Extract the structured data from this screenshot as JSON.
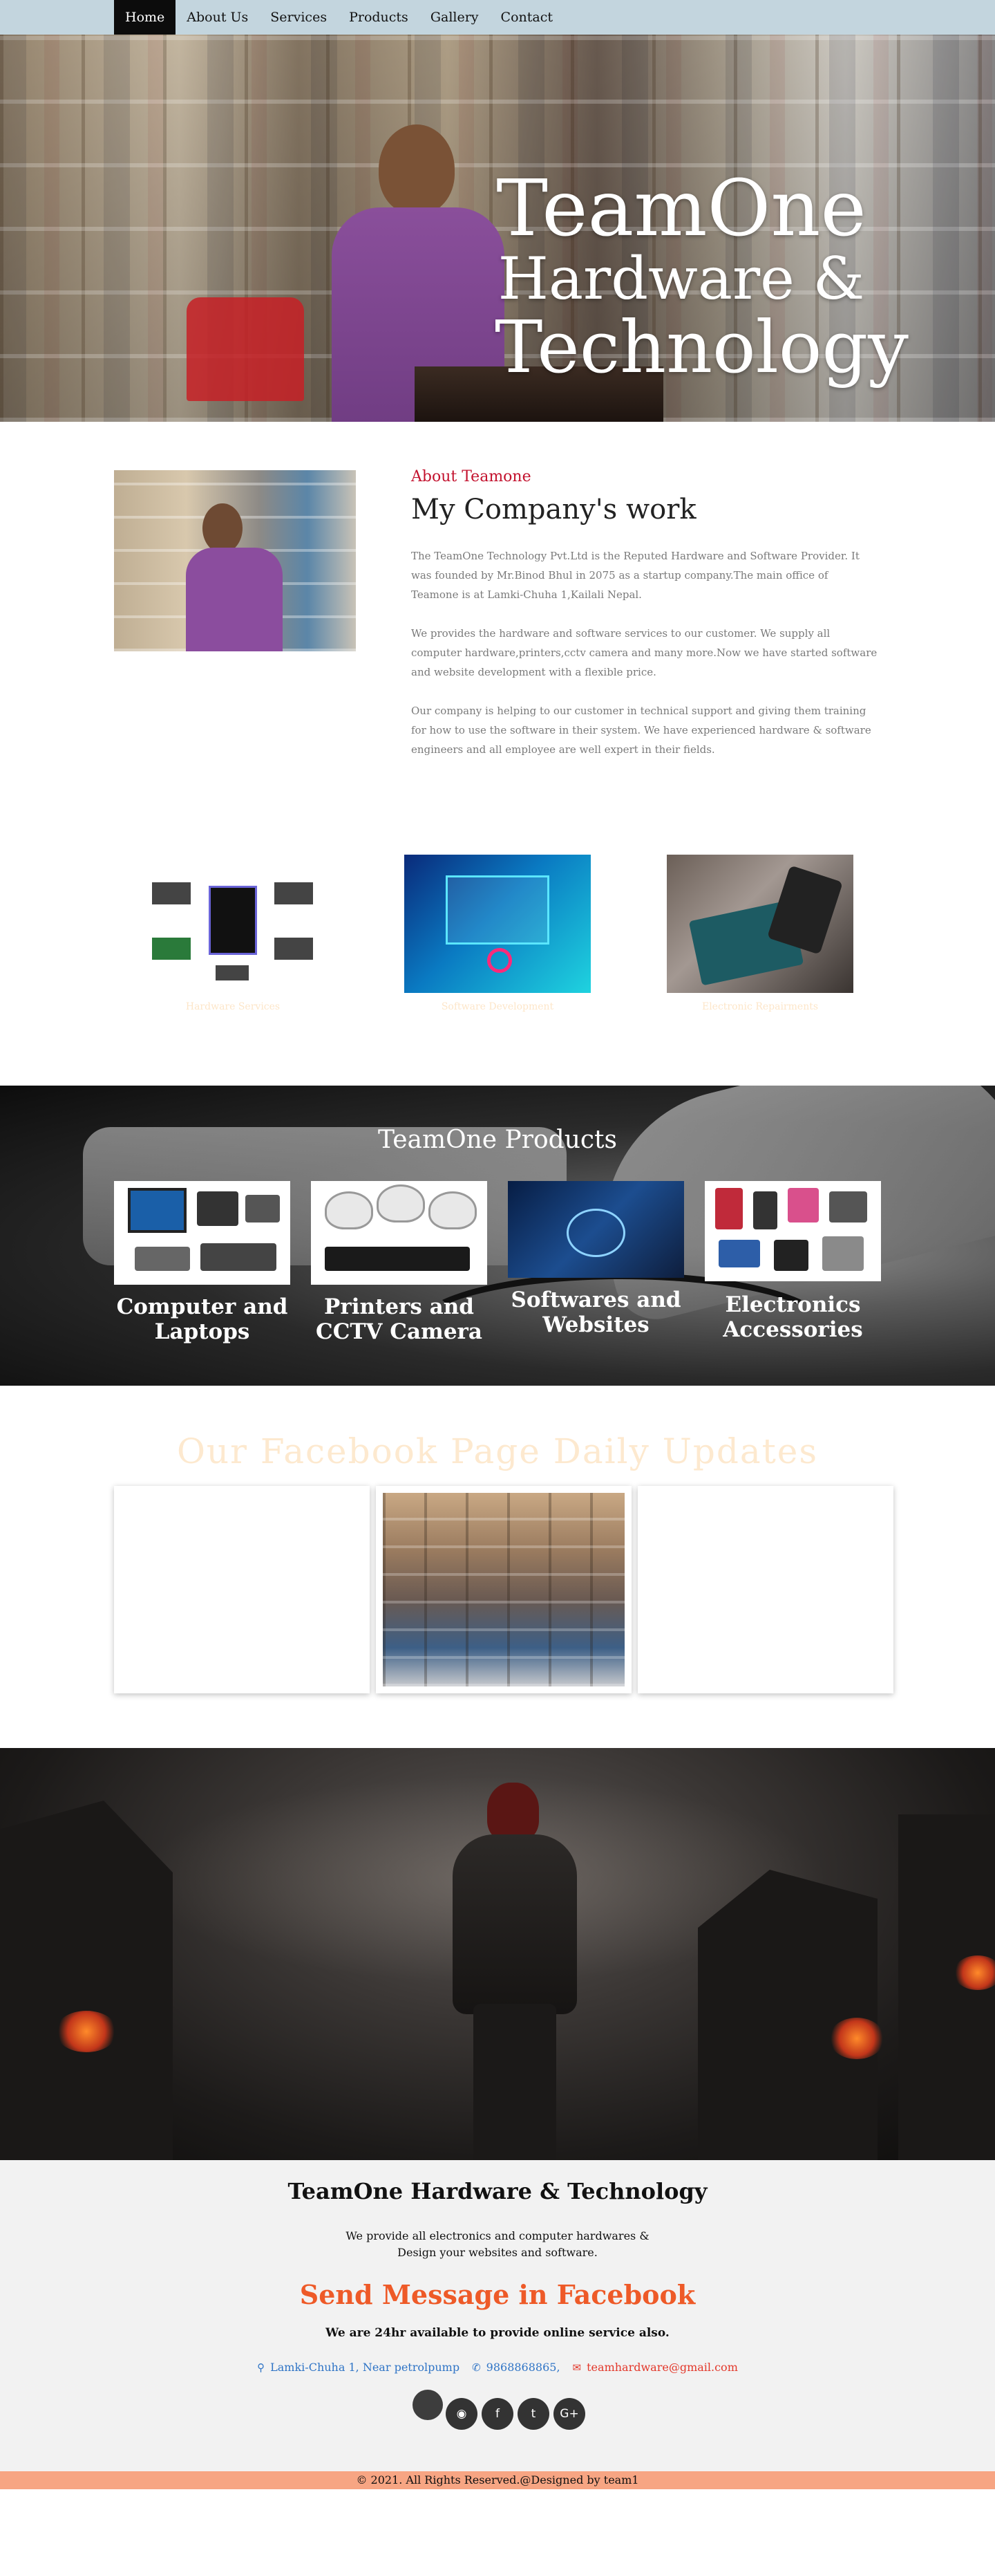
{
  "nav": {
    "items": [
      {
        "label": "Home",
        "active": true
      },
      {
        "label": "About Us"
      },
      {
        "label": "Services"
      },
      {
        "label": "Products"
      },
      {
        "label": "Gallery"
      },
      {
        "label": "Contact"
      }
    ]
  },
  "hero": {
    "line1": "TeamOne",
    "line2": "Hardware &",
    "line3": "Technology"
  },
  "about": {
    "label": "About Teamone",
    "heading": "My Company's work",
    "paragraphs": [
      "The TeamOne Technology Pvt.Ltd is the Reputed Hardware and Software Provider. It was founded by Mr.Binod Bhul in 2075 as a startup company.The main office of Teamone is at Lamki-Chuha 1,Kailali Nepal.",
      "We provides the hardware and software services to our customer. We supply all computer hardware,printers,cctv camera and many more.Now we have started software and website development with a flexible price.",
      "Our company is helping to our customer in technical support and giving them training for how to use the software in their system. We have experienced hardware & software engineers and all employee are well expert in their fields."
    ]
  },
  "services": {
    "items": [
      {
        "caption": "Hardware Services"
      },
      {
        "caption": "Software Development"
      },
      {
        "caption": "Electronic Repairments"
      }
    ]
  },
  "products": {
    "title": "TeamOne Products",
    "items": [
      {
        "line1": "Computer and",
        "line2": "Laptops"
      },
      {
        "line1": "Printers and",
        "line2": "CCTV Camera"
      },
      {
        "line1": "Softwares and",
        "line2": "Websites"
      },
      {
        "line1": "Electronics",
        "line2": "Accessories"
      }
    ]
  },
  "facebook": {
    "title": "Our Facebook Page Daily Updates"
  },
  "footer": {
    "title": "TeamOne Hardware & Technology",
    "desc_line1": "We provide all electronics and computer hardwares &",
    "desc_line2": "Design your websites and software.",
    "send": "Send Message in Facebook",
    "availability": "We are 24hr available to provide online service also.",
    "address": "Lamki-Chuha 1, Near petrolpump",
    "phone": "9868868865,",
    "email": "teamhardware@gmail.com",
    "social": [
      "rss-icon",
      "facebook-icon",
      "twitter-icon",
      "google-plus-icon"
    ],
    "copyright": "© 2021. All Rights Reserved.@Designed by team1"
  },
  "colors": {
    "nav_bg": "#c3d5de",
    "accent_red": "#c3122e",
    "send_orange": "#ee5a28",
    "link_blue": "#2f74c6",
    "copyright_bg": "#f7a583"
  }
}
